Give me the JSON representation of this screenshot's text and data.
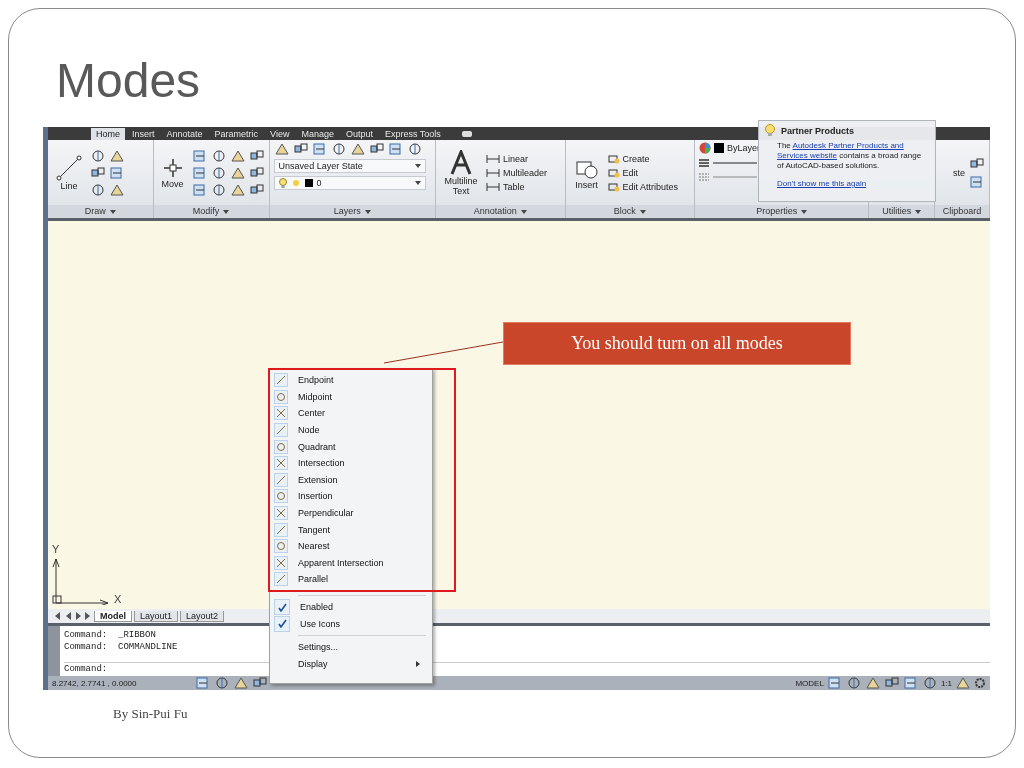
{
  "slide": {
    "title": "Modes",
    "footer": "By Sin-Pui Fu"
  },
  "ribbon": {
    "tabs": [
      {
        "label": "Home",
        "selected": true
      },
      {
        "label": "Insert",
        "selected": false
      },
      {
        "label": "Annotate",
        "selected": false
      },
      {
        "label": "Parametric",
        "selected": false
      },
      {
        "label": "View",
        "selected": false
      },
      {
        "label": "Manage",
        "selected": false
      },
      {
        "label": "Output",
        "selected": false
      },
      {
        "label": "Express Tools",
        "selected": false
      }
    ],
    "draw": {
      "title": "Draw",
      "big_tool": "Line"
    },
    "modify": {
      "title": "Modify",
      "big_tool": "Move"
    },
    "layers": {
      "title": "Layers",
      "layer_state": "Unsaved Layer State",
      "current_layer": "0"
    },
    "annotation": {
      "title": "Annotation",
      "big_tool": "Multiline Text",
      "tools": [
        "Linear",
        "Multileader",
        "Table"
      ]
    },
    "block": {
      "title": "Block",
      "big_tool": "Insert",
      "tools": [
        "Create",
        "Edit",
        "Edit Attributes"
      ]
    },
    "properties": {
      "title": "Properties",
      "color_label": "ByLayer"
    },
    "utilities": {
      "title": "Utilities"
    },
    "clipboard": {
      "title": "Clipboard",
      "big_tool": "ste"
    }
  },
  "popup": {
    "title": "Partner Products",
    "text_before": "The ",
    "link": [
      "Autodesk Partner Products and",
      "Services website"
    ],
    "text_after": " contains a broad range of AutoCAD-based solutions.",
    "dismiss": "Don't show me this again"
  },
  "callout": "You should turn on all modes",
  "axes": {
    "y": "Y",
    "x": "X"
  },
  "layout_tabs": [
    {
      "label": "Model",
      "selected": true
    },
    {
      "label": "Layout1",
      "selected": false
    },
    {
      "label": "Layout2",
      "selected": false
    }
  ],
  "command_history": [
    "Command:  _RIBBON",
    "Command:  COMMANDLINE"
  ],
  "command_prompt": "Command:",
  "status_bar": {
    "coordinates": "8.2742, 2.7741 , 0.0000",
    "space": "MODEL",
    "scale": "1:1"
  },
  "menu": [
    {
      "kind": "snap",
      "label": "Endpoint"
    },
    {
      "kind": "snap",
      "label": "Midpoint"
    },
    {
      "kind": "snap",
      "label": "Center"
    },
    {
      "kind": "snap",
      "label": "Node"
    },
    {
      "kind": "snap",
      "label": "Quadrant"
    },
    {
      "kind": "snap",
      "label": "Intersection"
    },
    {
      "kind": "snap",
      "label": "Extension"
    },
    {
      "kind": "snap",
      "label": "Insertion"
    },
    {
      "kind": "snap",
      "label": "Perpendicular"
    },
    {
      "kind": "snap",
      "label": "Tangent"
    },
    {
      "kind": "snap",
      "label": "Nearest"
    },
    {
      "kind": "snap",
      "label": "Apparent Intersection"
    },
    {
      "kind": "snap",
      "label": "Parallel"
    },
    {
      "kind": "toggle",
      "label": "Enabled",
      "checked": true
    },
    {
      "kind": "toggle",
      "label": "Use Icons",
      "checked": true
    },
    {
      "kind": "action",
      "label": "Settings..."
    },
    {
      "kind": "submenu",
      "label": "Display"
    }
  ]
}
